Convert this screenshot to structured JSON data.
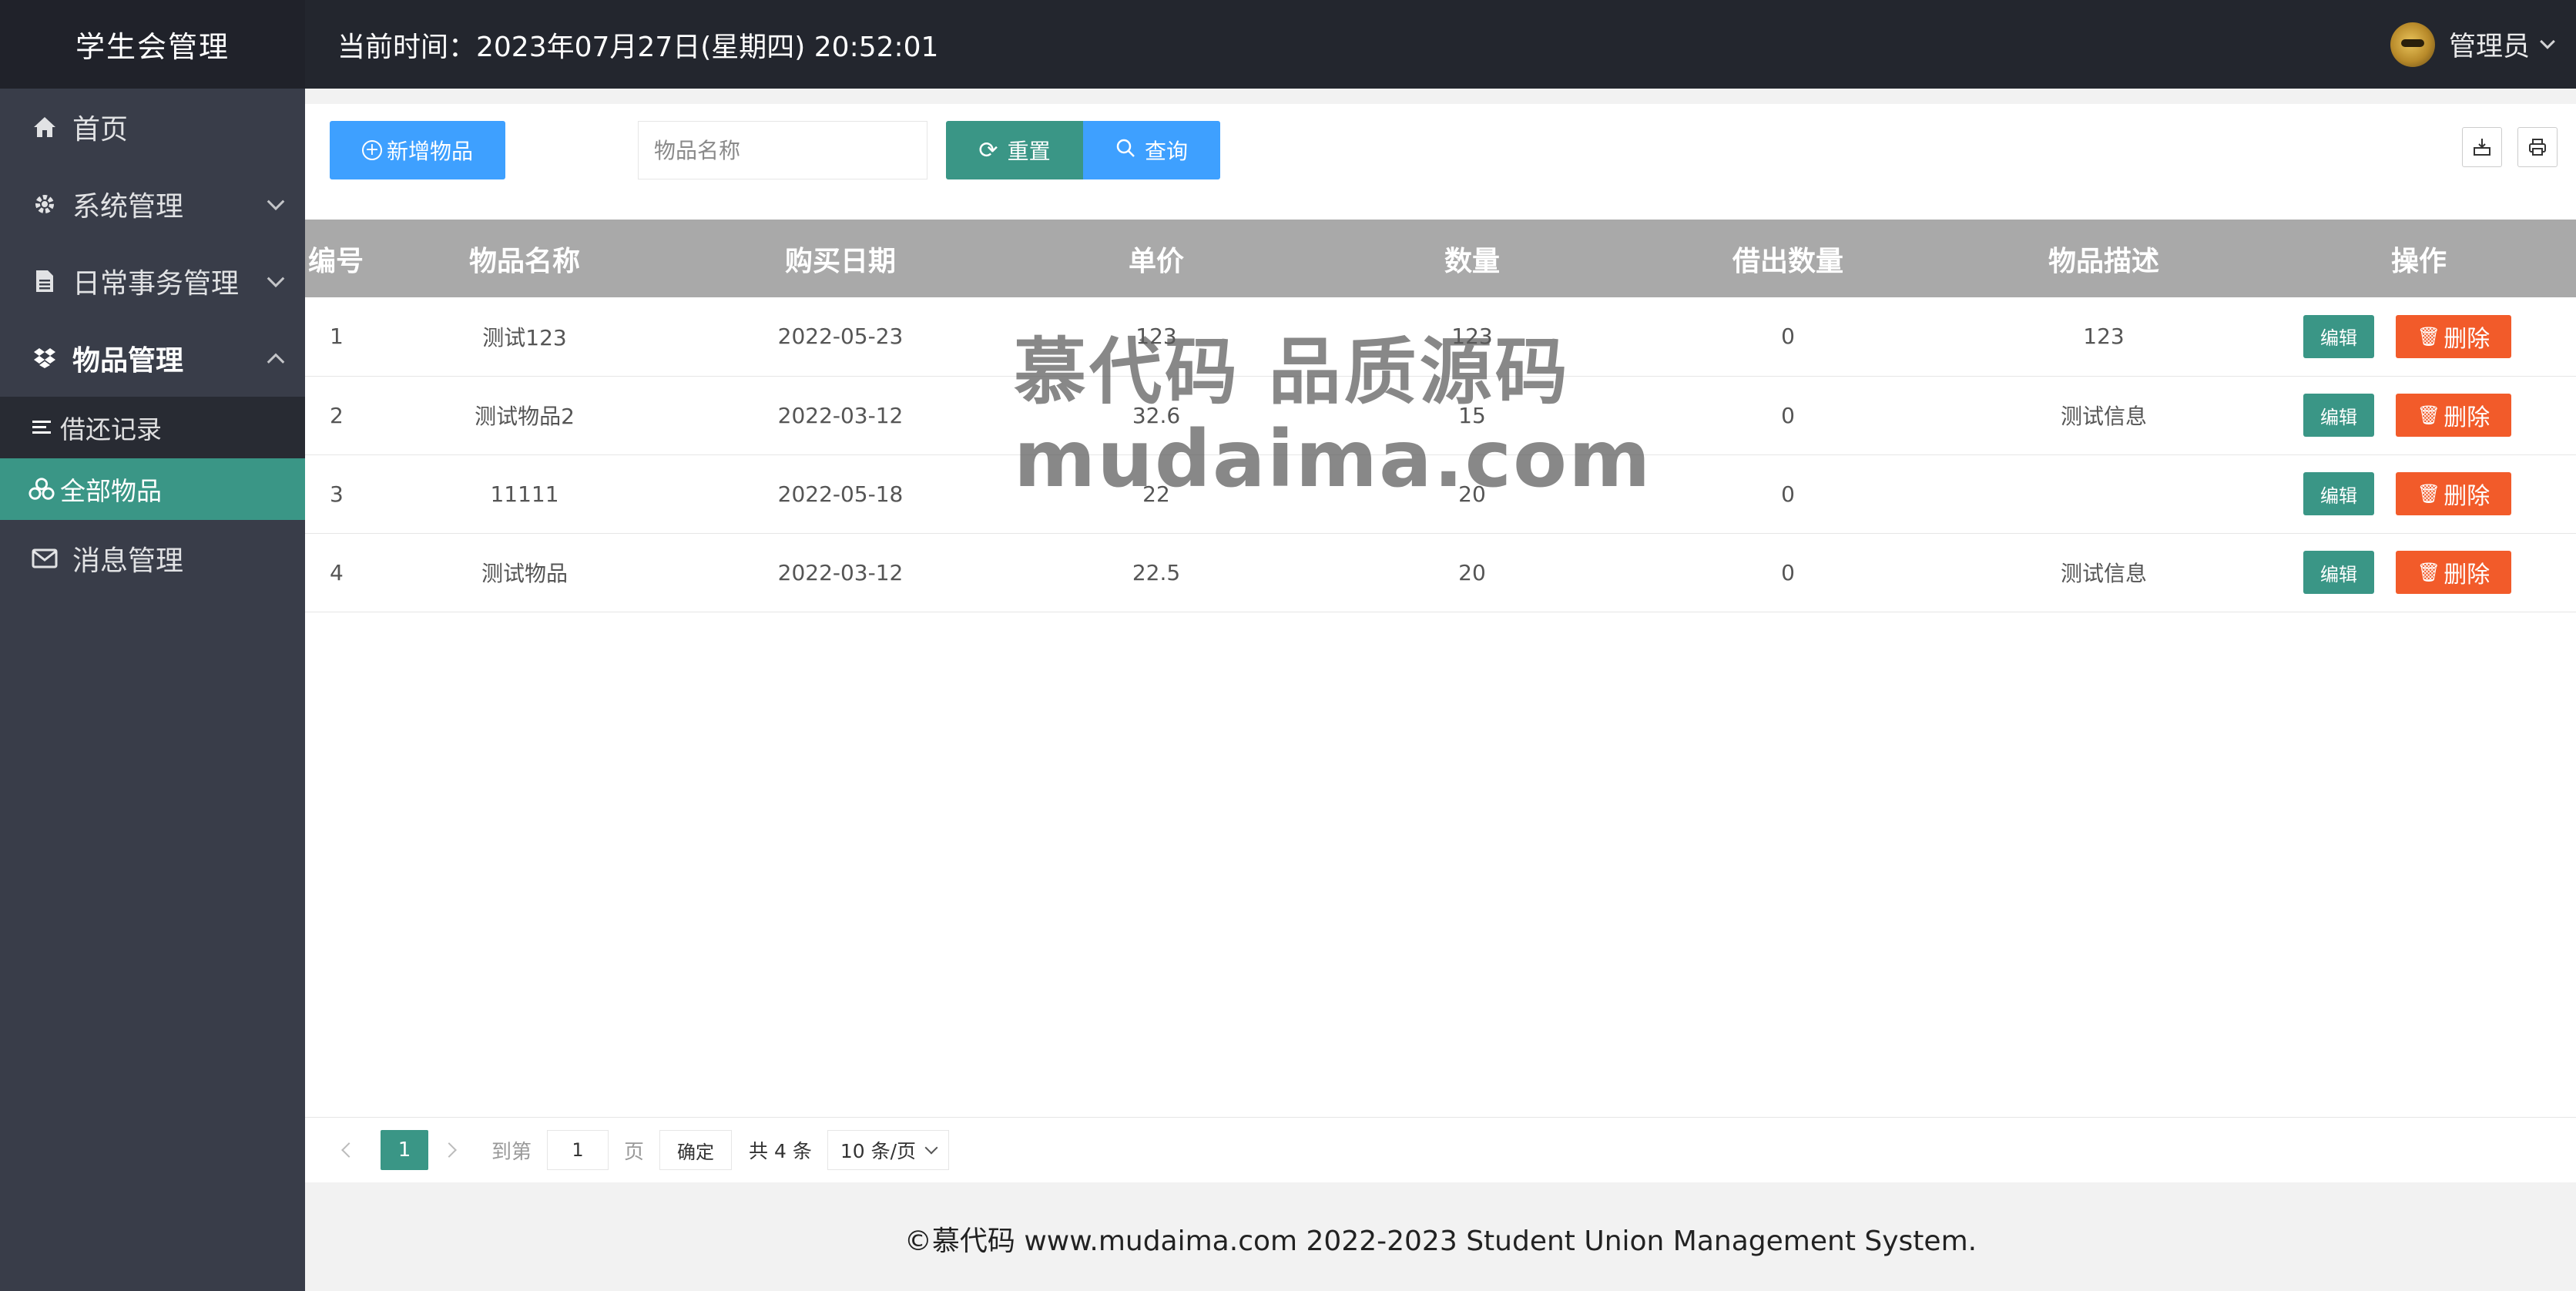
{
  "sidebar": {
    "title": "学生会管理",
    "items": [
      {
        "label": "首页",
        "icon": "home-icon"
      },
      {
        "label": "系统管理",
        "icon": "gear-icon"
      },
      {
        "label": "日常事务管理",
        "icon": "document-icon"
      },
      {
        "label": "物品管理",
        "icon": "dropbox-icon"
      },
      {
        "label": "消息管理",
        "icon": "envelope-icon"
      }
    ],
    "children": [
      {
        "label": "借还记录",
        "icon": "list-icon"
      },
      {
        "label": "全部物品",
        "icon": "cubes-icon"
      }
    ]
  },
  "header": {
    "time_text": "当前时间：2023年07月27日(星期四) 20:52:01",
    "user_name": "管理员"
  },
  "toolbar": {
    "add_label": "新增物品",
    "search_placeholder": "物品名称",
    "reset_label": "重置",
    "query_label": "查询"
  },
  "table": {
    "columns": [
      "编号",
      "物品名称",
      "购买日期",
      "单价",
      "数量",
      "借出数量",
      "物品描述",
      "操作"
    ],
    "rows": [
      {
        "id": "1",
        "name": "测试123",
        "date": "2022-05-23",
        "price": "123",
        "qty": "123",
        "lent": "0",
        "desc": "123"
      },
      {
        "id": "2",
        "name": "测试物品2",
        "date": "2022-03-12",
        "price": "32.6",
        "qty": "15",
        "lent": "0",
        "desc": "测试信息"
      },
      {
        "id": "3",
        "name": "11111",
        "date": "2022-05-18",
        "price": "22",
        "qty": "20",
        "lent": "0",
        "desc": ""
      },
      {
        "id": "4",
        "name": "测试物品",
        "date": "2022-03-12",
        "price": "22.5",
        "qty": "20",
        "lent": "0",
        "desc": "测试信息"
      }
    ],
    "edit_label": "编辑",
    "delete_label": "删除"
  },
  "pager": {
    "current": "1",
    "goto_label": "到第",
    "goto_value": "1",
    "page_label": "页",
    "confirm_label": "确定",
    "total_text": "共 4 条",
    "page_size": "10 条/页"
  },
  "footer": {
    "text": "©慕代码 www.mudaima.com 2022-2023 Student Union Management System."
  },
  "watermark": {
    "line1": "慕代码 品质源码",
    "line2": "mudaima.com"
  },
  "colors": {
    "sidebar_bg": "#393d49",
    "header_bg": "#23262e",
    "active_green": "#3a9686",
    "primary_blue": "#3ea0ff",
    "danger_orange": "#f25b2a",
    "table_header": "#a9a9a9"
  }
}
